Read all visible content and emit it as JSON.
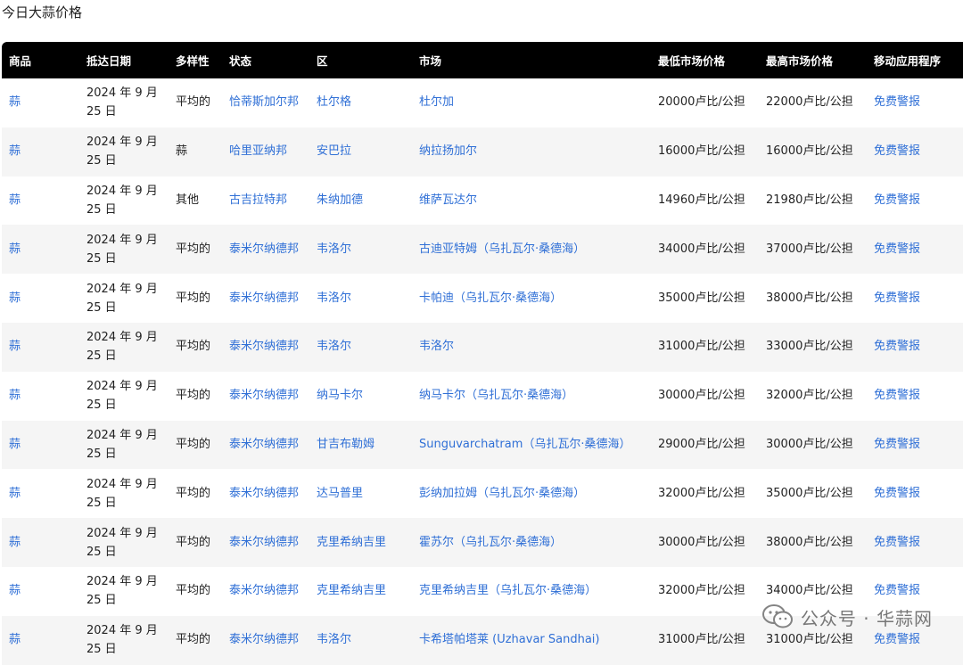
{
  "page_title": "今日大蒜价格",
  "table": {
    "headers": [
      "商品",
      "抵达日期",
      "多样性",
      "状态",
      "区",
      "市场",
      "最低市场价格",
      "最高市场价格",
      "移动应用程序"
    ],
    "rows": [
      {
        "commodity": "蒜",
        "date": "2024 年 9 月 25 日",
        "variety": "平均的",
        "state": "恰蒂斯加尔邦",
        "district": "杜尔格",
        "market": "杜尔加",
        "min_price": "20000卢比/公担",
        "max_price": "22000卢比/公担",
        "app": "免费警报"
      },
      {
        "commodity": "蒜",
        "date": "2024 年 9 月 25 日",
        "variety": "蒜",
        "state": "哈里亚纳邦",
        "district": "安巴拉",
        "market": "纳拉扬加尔",
        "min_price": "16000卢比/公担",
        "max_price": "16000卢比/公担",
        "app": "免费警报"
      },
      {
        "commodity": "蒜",
        "date": "2024 年 9 月 25 日",
        "variety": "其他",
        "state": "古吉拉特邦",
        "district": "朱纳加德",
        "market": "维萨瓦达尔",
        "min_price": "14960卢比/公担",
        "max_price": "21980卢比/公担",
        "app": "免费警报"
      },
      {
        "commodity": "蒜",
        "date": "2024 年 9 月 25 日",
        "variety": "平均的",
        "state": "泰米尔纳德邦",
        "district": "韦洛尔",
        "market": "古迪亚特姆（乌扎瓦尔·桑德海）",
        "min_price": "34000卢比/公担",
        "max_price": "37000卢比/公担",
        "app": "免费警报"
      },
      {
        "commodity": "蒜",
        "date": "2024 年 9 月 25 日",
        "variety": "平均的",
        "state": "泰米尔纳德邦",
        "district": "韦洛尔",
        "market": "卡帕迪（乌扎瓦尔·桑德海）",
        "min_price": "35000卢比/公担",
        "max_price": "38000卢比/公担",
        "app": "免费警报"
      },
      {
        "commodity": "蒜",
        "date": "2024 年 9 月 25 日",
        "variety": "平均的",
        "state": "泰米尔纳德邦",
        "district": "韦洛尔",
        "market": "韦洛尔",
        "min_price": "31000卢比/公担",
        "max_price": "33000卢比/公担",
        "app": "免费警报"
      },
      {
        "commodity": "蒜",
        "date": "2024 年 9 月 25 日",
        "variety": "平均的",
        "state": "泰米尔纳德邦",
        "district": "纳马卡尔",
        "market": "纳马卡尔（乌扎瓦尔·桑德海）",
        "min_price": "30000卢比/公担",
        "max_price": "32000卢比/公担",
        "app": "免费警报"
      },
      {
        "commodity": "蒜",
        "date": "2024 年 9 月 25 日",
        "variety": "平均的",
        "state": "泰米尔纳德邦",
        "district": "甘吉布勒姆",
        "market": "Sunguvarchatram（乌扎瓦尔·桑德海）",
        "min_price": "29000卢比/公担",
        "max_price": "30000卢比/公担",
        "app": "免费警报"
      },
      {
        "commodity": "蒜",
        "date": "2024 年 9 月 25 日",
        "variety": "平均的",
        "state": "泰米尔纳德邦",
        "district": "达马普里",
        "market": "彭纳加拉姆（乌扎瓦尔·桑德海）",
        "min_price": "32000卢比/公担",
        "max_price": "35000卢比/公担",
        "app": "免费警报"
      },
      {
        "commodity": "蒜",
        "date": "2024 年 9 月 25 日",
        "variety": "平均的",
        "state": "泰米尔纳德邦",
        "district": "克里希纳吉里",
        "market": "霍苏尔（乌扎瓦尔·桑德海）",
        "min_price": "30000卢比/公担",
        "max_price": "38000卢比/公担",
        "app": "免费警报"
      },
      {
        "commodity": "蒜",
        "date": "2024 年 9 月 25 日",
        "variety": "平均的",
        "state": "泰米尔纳德邦",
        "district": "克里希纳吉里",
        "market": "克里希纳吉里（乌扎瓦尔·桑德海）",
        "min_price": "32000卢比/公担",
        "max_price": "34000卢比/公担",
        "app": "免费警报"
      },
      {
        "commodity": "蒜",
        "date": "2024 年 9 月 25 日",
        "variety": "平均的",
        "state": "泰米尔纳德邦",
        "district": "韦洛尔",
        "market": "卡希塔帕塔莱 (Uzhavar Sandhai)",
        "min_price": "31000卢比/公担",
        "max_price": "31000卢比/公担",
        "app": "免费警报"
      }
    ]
  },
  "watermark": {
    "icon": "wechat-icon",
    "text": "公众号 · 华蒜网"
  },
  "colors": {
    "header_bg": "#000000",
    "link": "#2f6fd6",
    "stripe": "#f5f5f5"
  }
}
